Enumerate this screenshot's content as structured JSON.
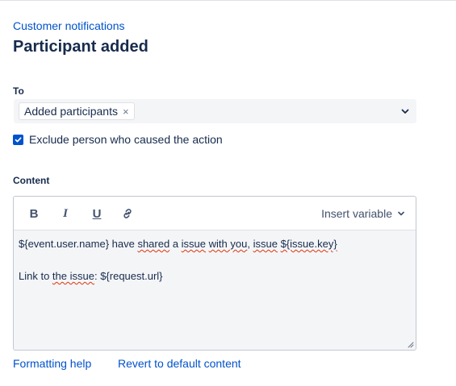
{
  "header": {
    "breadcrumb": "Customer notifications",
    "title": "Participant added"
  },
  "to_field": {
    "label": "To",
    "tags": [
      {
        "label": "Added participants",
        "remove_glyph": "×"
      }
    ],
    "chevron_icon": "chevron-down-icon"
  },
  "exclude_option": {
    "label": "Exclude person who caused the action",
    "checked": true
  },
  "content_field": {
    "label": "Content",
    "toolbar": {
      "bold_label": "B",
      "italic_label": "I",
      "underline_label": "U",
      "link_icon": "link-icon",
      "insert_variable_label": "Insert variable"
    },
    "body": {
      "line1": {
        "segments": [
          "${event.user.name} have ",
          "shared",
          " a ",
          "issue",
          " ",
          "with you",
          ", ",
          "issue",
          " ",
          "${issue.key}"
        ]
      },
      "line2": "",
      "line3": {
        "segments": [
          "Link to ",
          "the issue",
          ": ${request.url}"
        ]
      }
    }
  },
  "footer": {
    "formatting_help": "Formatting help",
    "revert_default": "Revert to default content"
  },
  "colors": {
    "link": "#0052cc",
    "text": "#172b4d",
    "field_background": "#f4f5f7",
    "checkbox": "#0052cc",
    "spellcheck": "#de350b"
  }
}
